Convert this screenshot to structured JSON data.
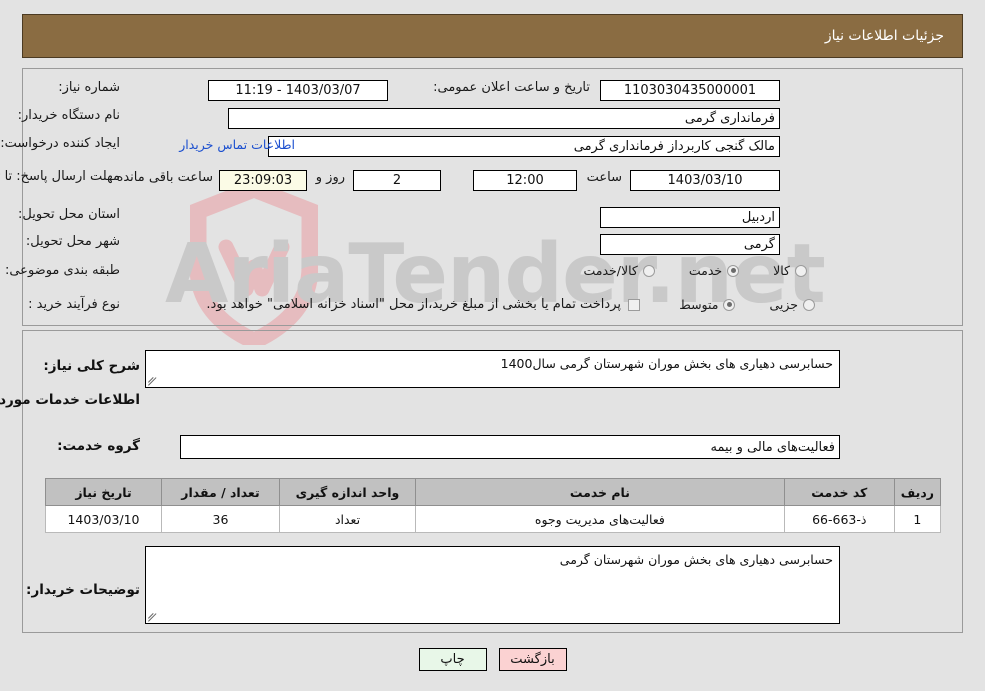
{
  "header": {
    "title": "جزئیات اطلاعات نیاز",
    "background_color": "#8a6c42",
    "text_color": "#ffffff"
  },
  "watermark": {
    "text": "AriaTender.net",
    "text_color": "#c9c9c9",
    "shield_color": "#e3b9bc"
  },
  "top_panel": {
    "fields": [
      {
        "label": "شماره نیاز:",
        "value": "1103030435000001"
      },
      {
        "label": "نام دستگاه خریدار:",
        "value": "فرمانداری گرمی"
      },
      {
        "label": "ایجاد کننده درخواست:",
        "value": "مالک گنجی کاربرداز فرمانداری گرمی"
      },
      {
        "label": "مهلت ارسال پاسخ: تا تاریخ:",
        "value": "1403/03/10"
      },
      {
        "label": "استان محل تحویل:",
        "value": "اردبیل"
      },
      {
        "label": "شهر محل تحویل:",
        "value": "گرمی"
      }
    ],
    "announce": {
      "label": "تاریخ و ساعت اعلان عمومی:",
      "value": "1403/03/07 - 11:19"
    },
    "buyer_contact_link": "اطلاعات تماس خریدار",
    "deadline": {
      "hour_label": "ساعت",
      "hour_value": "12:00",
      "days_value": "2",
      "days_label": "روز و",
      "countdown_value": "23:09:03",
      "countdown_suffix": "ساعت باقی مانده",
      "countdown_bg": "#fbfbe6"
    },
    "classification": {
      "label": "طبقه بندی موضوعی:",
      "options": [
        {
          "text": "کالا",
          "selected": false
        },
        {
          "text": "خدمت",
          "selected": true
        },
        {
          "text": "کالا/خدمت",
          "selected": false
        }
      ]
    },
    "purchase_process": {
      "label": "نوع فرآیند خرید :",
      "options": [
        {
          "text": "جزیی",
          "selected": false
        },
        {
          "text": "متوسط",
          "selected": true
        }
      ],
      "checkbox_label": "پرداخت تمام یا بخشی از مبلغ خرید،از محل \"اسناد خزانه اسلامی\" خواهد بود.",
      "checkbox_checked": false
    }
  },
  "mid_panel": {
    "general_description": {
      "label": "شرح کلی نیاز:",
      "value": "حسابرسی دهیاری های بخش موران شهرستان گرمی سال1400"
    },
    "services_section_title": "اطلاعات خدمات مورد نیاز",
    "service_group": {
      "label": "گروه خدمت:",
      "value": "فعالیت‌های مالی و بیمه"
    },
    "table": {
      "headers": [
        "ردیف",
        "کد خدمت",
        "نام خدمت",
        "واحد اندازه گیری",
        "تعداد / مقدار",
        "تاریخ نیاز"
      ],
      "rows": [
        {
          "row_no": "1",
          "service_code": "ذ-663-66",
          "service_name": "فعالیت‌های مدیریت وجوه",
          "unit": "تعداد",
          "quantity": "36",
          "need_date": "1403/03/10"
        }
      ]
    },
    "buyer_notes": {
      "label": "توضیحات خریدار:",
      "value": "حسابرسی دهیاری های بخش موران شهرستان گرمی"
    }
  },
  "buttons": {
    "print": {
      "label": "چاپ",
      "background": "#e8f7e8"
    },
    "back": {
      "label": "بازگشت",
      "background": "#fbd2d2"
    }
  }
}
